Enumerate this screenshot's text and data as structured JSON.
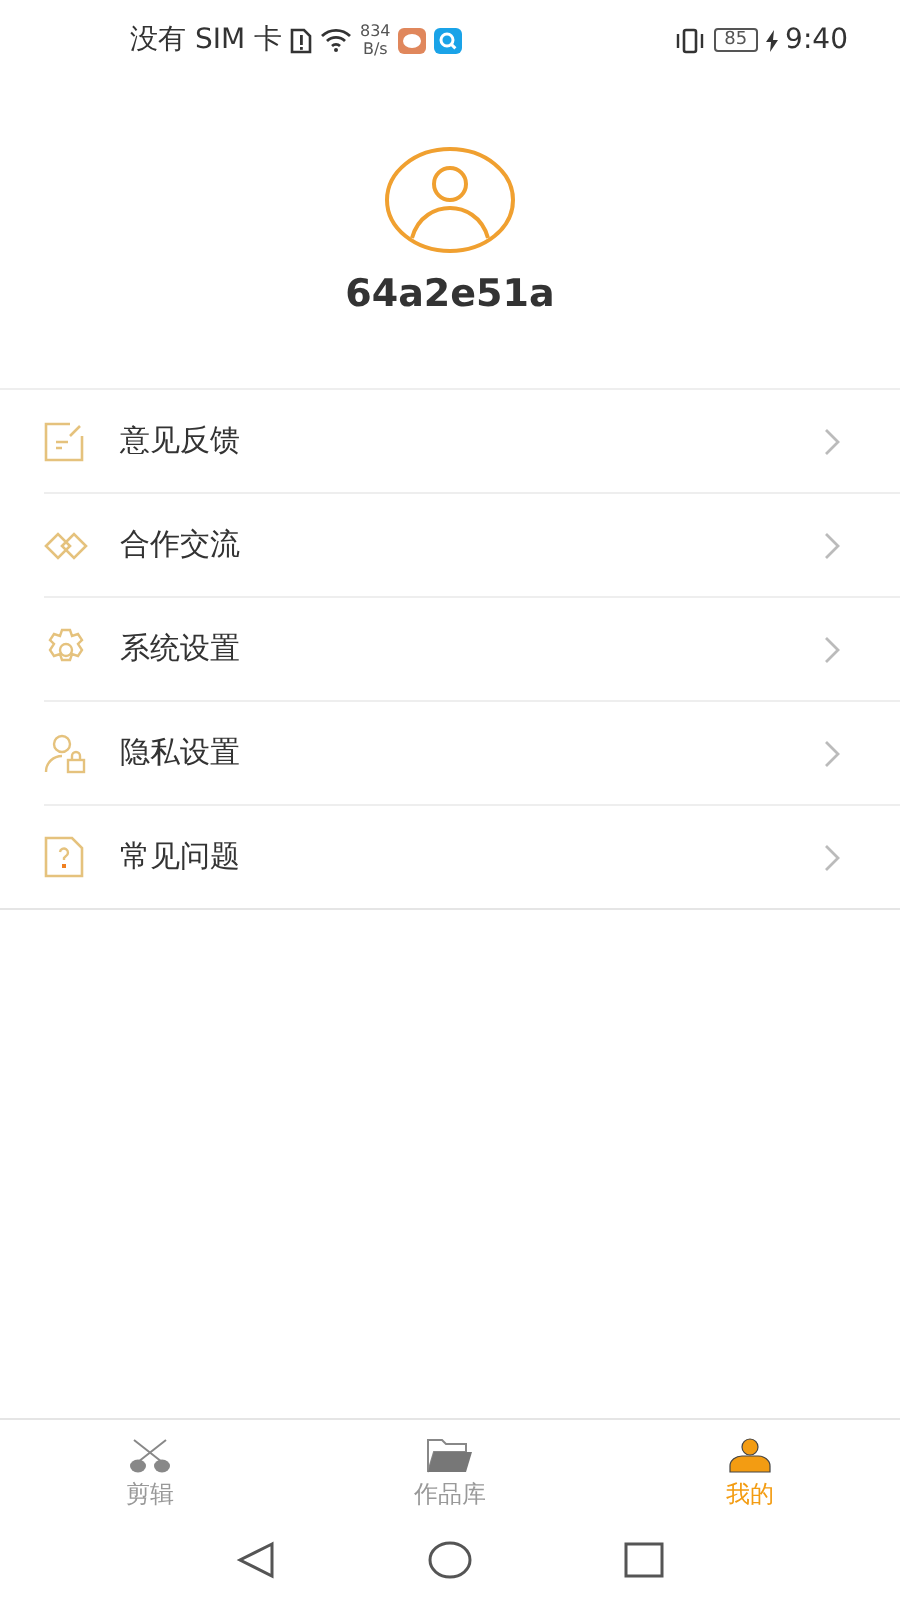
{
  "status_bar": {
    "carrier": "没有 SIM 卡",
    "speed_value": "834",
    "speed_unit": "B/s",
    "battery": "85",
    "time": "9:40"
  },
  "profile": {
    "username": "64a2e51a"
  },
  "menu": [
    {
      "kind": "feedback",
      "label": "意见反馈"
    },
    {
      "kind": "handshake",
      "label": "合作交流"
    },
    {
      "kind": "settings",
      "label": "系统设置"
    },
    {
      "kind": "privacy",
      "label": "隐私设置"
    },
    {
      "kind": "faq",
      "label": "常见问题"
    }
  ],
  "tabs": [
    {
      "kind": "edit",
      "label": "剪辑",
      "selected": false
    },
    {
      "kind": "library",
      "label": "作品库",
      "selected": false
    },
    {
      "kind": "mine",
      "label": "我的",
      "selected": true
    }
  ]
}
